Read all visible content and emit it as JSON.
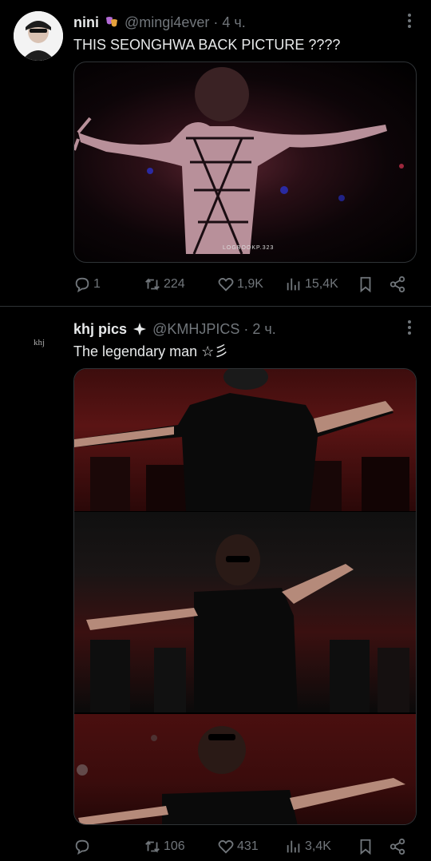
{
  "tweets": [
    {
      "author_name": "nini",
      "handle": "@mingi4ever",
      "separator": "·",
      "time": "4 ч.",
      "text": "THIS SEONGHWA BACK PICTURE ????",
      "media_watermark": "LOGBOOKP.323",
      "stats": {
        "replies": "1",
        "retweets": "224",
        "likes": "1,9K",
        "views": "15,4K"
      }
    },
    {
      "author_name": "khj pics",
      "handle": "@KMHJPICS",
      "separator": "·",
      "time": "2 ч.",
      "text": "The legendary man ☆彡",
      "avatar_text": "khj",
      "stats": {
        "replies": "",
        "retweets": "106",
        "likes": "431",
        "views": "3,4K"
      }
    }
  ],
  "icons": {
    "reply": "reply-icon",
    "retweet": "retweet-icon",
    "like": "heart-icon",
    "views": "views-chart-icon",
    "bookmark": "bookmark-icon",
    "share": "share-icon",
    "more": "more-dots-icon",
    "badge1": "theater-masks-icon",
    "badge2": "sparkle-icon"
  },
  "colors": {
    "background": "#000000",
    "text": "#e7e9ea",
    "muted": "#71767b",
    "divider": "#2f3336"
  }
}
